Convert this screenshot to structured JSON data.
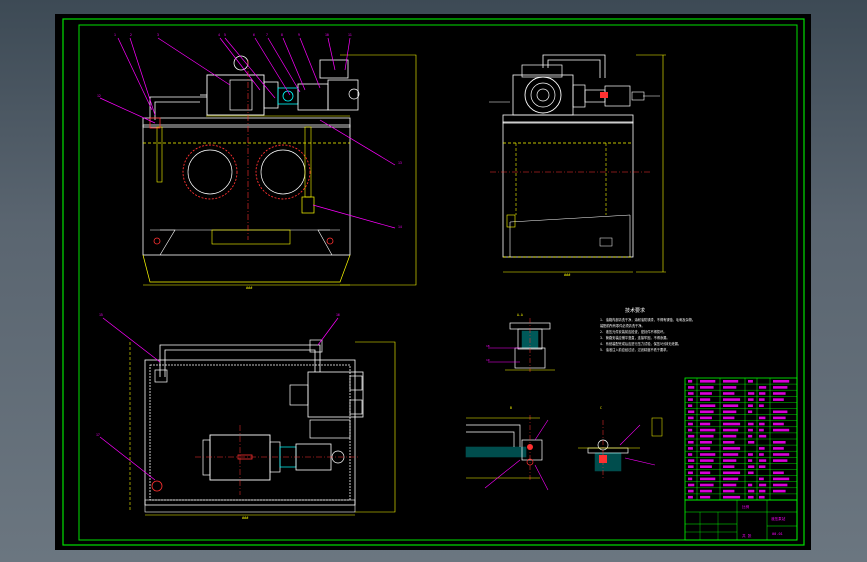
{
  "colors": {
    "background": "#000000",
    "outer_frame": "#00e000",
    "inner_frame": "#00e000",
    "geometry": "#ffffff",
    "dimension": "#ffff00",
    "leader": "#ff00ff",
    "centerline": "#ff2020",
    "hidden": "#ffff00",
    "detail": "#00ffff",
    "titleblock_text": "#ff00ff",
    "titleblock_lines": "#00ff00"
  },
  "technical_requirements": {
    "heading": "技术要求",
    "items": [
      "1. 油箱内部清洗干净，涂耐油防锈漆，不得有锈蚀、毛刺及杂物。",
      "   装配前所有零件必须清洗干净。",
      "2. 液压元件安装前应检查，密封件不得损坏。",
      "3. 管路安装应横平竖直，连接牢固，不得渗漏。",
      "4. 系统装配完成后应进行压力试验，保压5分钟无泄漏。",
      "5. 油液注入前应经过滤，过滤精度不低于要求。"
    ]
  },
  "title_block": {
    "drawing_name": "液压泵站",
    "drawing_no": "00-01",
    "scale_label": "比例",
    "sheet_label": "共 张"
  }
}
